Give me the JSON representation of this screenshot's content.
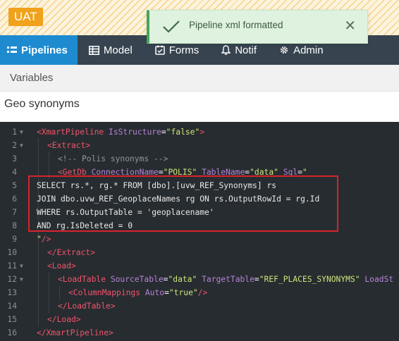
{
  "env": {
    "badge": "UAT"
  },
  "toast": {
    "message": "Pipeline xml formatted",
    "close_glyph": "✕",
    "icon": "check-icon"
  },
  "nav": {
    "items": [
      {
        "label": "Pipelines",
        "icon": "pipelines-icon",
        "active": true
      },
      {
        "label": "Model",
        "icon": "table-icon"
      },
      {
        "label": "Forms",
        "icon": "form-icon"
      },
      {
        "label": "Notif",
        "icon": "bell-icon"
      },
      {
        "label": "Admin",
        "icon": "gear-icon"
      }
    ]
  },
  "subheader": {
    "label": "Variables"
  },
  "title": {
    "label": "Geo synonyms"
  },
  "colors": {
    "nav_bg": "#374450",
    "nav_active": "#1e8bd0",
    "badge": "#f0a21c",
    "editor_bg": "#272c30",
    "highlight": "#d8232a"
  },
  "editor": {
    "line_numbers": [
      "1",
      "2",
      "3",
      "4",
      "5",
      "6",
      "7",
      "8",
      "9",
      "10",
      "11",
      "12",
      "13",
      "14",
      "15",
      "16"
    ],
    "l1": {
      "open": "<XmartPipeline",
      "attr1": "IsStructure",
      "eq": "=",
      "val1": "\"false\"",
      "close": ">"
    },
    "l2": {
      "tag": "<Extract>"
    },
    "l3": {
      "comment": "<!-- Polis synonyms -->"
    },
    "l4": {
      "open": "<GetDb",
      "attr1": "ConnectionName",
      "eq": "=",
      "val1": "\"POLIS\"",
      "attr2": "TableName",
      "val2": "\"data\"",
      "attr3": "Sql",
      "val3": "\""
    },
    "l5": {
      "text": "SELECT rs.*, rg.* FROM [dbo].[uvw_REF_Synonyms] rs"
    },
    "l6": {
      "text": "JOIN dbo.uvw_REF_GeoplaceNames rg ON rs.OutputRowId = rg.Id"
    },
    "l7": {
      "text": "WHERE rs.OutputTable = 'geoplacename'"
    },
    "l8": {
      "text": "AND rg.IsDeleted = 0"
    },
    "l9": {
      "quote": "\"",
      "close": "/>"
    },
    "l10": {
      "tag": "</Extract>"
    },
    "l11": {
      "tag": "<Load>"
    },
    "l12": {
      "open": "<LoadTable",
      "attr1": "SourceTable",
      "eq": "=",
      "val1": "\"data\"",
      "attr2": "TargetTable",
      "val2": "\"REF_PLACES_SYNONYMS\"",
      "attr3": "LoadSt"
    },
    "l13": {
      "open": "<ColumnMappings",
      "attr1": "Auto",
      "eq": "=",
      "val1": "\"true\"",
      "close": "/>"
    },
    "l14": {
      "tag": "</LoadTable>"
    },
    "l15": {
      "tag": "</Load>"
    },
    "l16": {
      "tag": "</XmartPipeline>"
    }
  }
}
